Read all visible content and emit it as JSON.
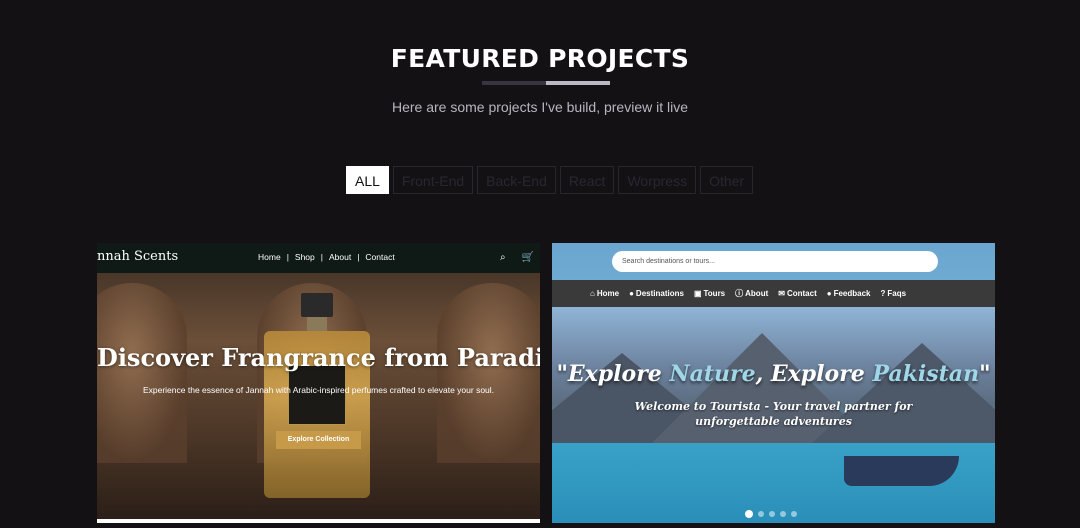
{
  "section": {
    "title": "FEATURED PROJECTS",
    "subtitle": "Here are some projects I've build, preview it live"
  },
  "filters": [
    "ALL",
    "Front-End",
    "Back-End",
    "React",
    "Worpress",
    "Other"
  ],
  "active_filter": "ALL",
  "card1": {
    "logo": "nnah Scents",
    "nav": [
      "Home",
      "Shop",
      "About",
      "Contact"
    ],
    "hero_title": "Discover Frangrance from Paradise",
    "hero_desc": "Experience the essence of Jannah with Arabic-inspired perfumes crafted to elevate your soul.",
    "button": "Explore Collection",
    "bottle_label": [
      "JANNAH SCENTS",
      "AL NARIE"
    ],
    "icons": [
      "search-icon",
      "cart-icon"
    ]
  },
  "card2": {
    "search_placeholder": "Search destinations or tours...",
    "nav": [
      "Home",
      "Destinations",
      "Tours",
      "About",
      "Contact",
      "Feedback",
      "Faqs"
    ],
    "hero_title_parts": [
      "\"Explore ",
      "Nature",
      ", Explore ",
      "Pakistan",
      "\""
    ],
    "hero_sub": "Welcome to Tourista - Your travel partner for unforgettable adventures",
    "slides": 5,
    "active_slide": 1
  },
  "colors": {
    "background": "#141115",
    "accent_gold": "#c79a4a",
    "highlight_blue": "#9fd6e8"
  }
}
